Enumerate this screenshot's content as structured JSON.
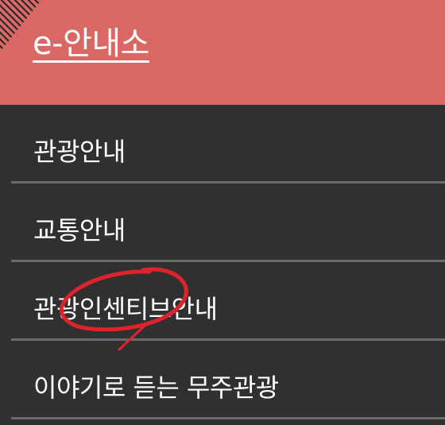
{
  "header": {
    "title": "e-안내소"
  },
  "menu": {
    "items": [
      {
        "label": "관광안내"
      },
      {
        "label": "교통안내"
      },
      {
        "label": "관광인센티브안내"
      },
      {
        "label": "이야기로 듣는 무주관광"
      }
    ]
  },
  "colors": {
    "header_bg": "#d96763",
    "menu_bg": "#303030",
    "divider": "#6a6a6a",
    "annotation": "#e0232a"
  }
}
